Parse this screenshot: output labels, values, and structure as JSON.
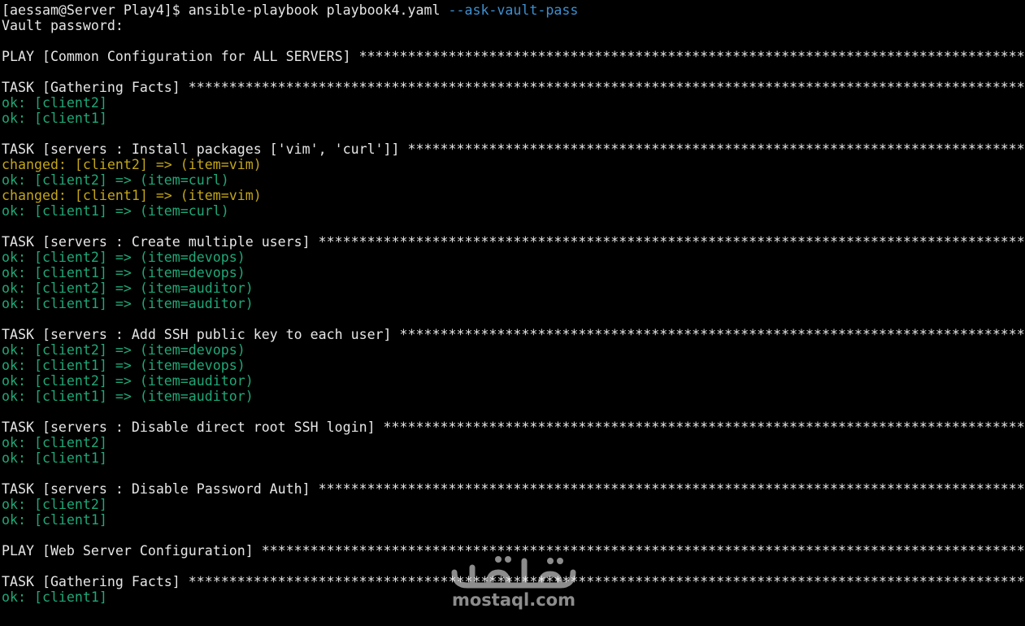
{
  "terminal": {
    "prompt": "[aessam@Server Play4]$ ",
    "command": "ansible-playbook playbook4.yaml ",
    "command_flag": "--ask-vault-pass",
    "vault_prompt": "Vault password:",
    "stars": "***************************************************************************************************************************"
  },
  "blocks": [
    {
      "header": "PLAY [Common Configuration for ALL SERVERS] ",
      "results": []
    },
    {
      "header": "TASK [Gathering Facts] ",
      "results": [
        {
          "status": "ok",
          "text": "ok: [client2]"
        },
        {
          "status": "ok",
          "text": "ok: [client1]"
        }
      ]
    },
    {
      "header": "TASK [servers : Install packages ['vim', 'curl']] ",
      "results": [
        {
          "status": "changed",
          "text": "changed: [client2] => (item=vim)"
        },
        {
          "status": "ok",
          "text": "ok: [client2] => (item=curl)"
        },
        {
          "status": "changed",
          "text": "changed: [client1] => (item=vim)"
        },
        {
          "status": "ok",
          "text": "ok: [client1] => (item=curl)"
        }
      ]
    },
    {
      "header": "TASK [servers : Create multiple users] ",
      "results": [
        {
          "status": "ok",
          "text": "ok: [client2] => (item=devops)"
        },
        {
          "status": "ok",
          "text": "ok: [client1] => (item=devops)"
        },
        {
          "status": "ok",
          "text": "ok: [client2] => (item=auditor)"
        },
        {
          "status": "ok",
          "text": "ok: [client1] => (item=auditor)"
        }
      ]
    },
    {
      "header": "TASK [servers : Add SSH public key to each user] ",
      "results": [
        {
          "status": "ok",
          "text": "ok: [client2] => (item=devops)"
        },
        {
          "status": "ok",
          "text": "ok: [client1] => (item=devops)"
        },
        {
          "status": "ok",
          "text": "ok: [client2] => (item=auditor)"
        },
        {
          "status": "ok",
          "text": "ok: [client1] => (item=auditor)"
        }
      ]
    },
    {
      "header": "TASK [servers : Disable direct root SSH login] ",
      "results": [
        {
          "status": "ok",
          "text": "ok: [client2]"
        },
        {
          "status": "ok",
          "text": "ok: [client1]"
        }
      ]
    },
    {
      "header": "TASK [servers : Disable Password Auth] ",
      "results": [
        {
          "status": "ok",
          "text": "ok: [client2]"
        },
        {
          "status": "ok",
          "text": "ok: [client1]"
        }
      ]
    },
    {
      "header": "PLAY [Web Server Configuration] ",
      "results": []
    },
    {
      "header": "TASK [Gathering Facts] ",
      "results": [
        {
          "status": "ok",
          "text": "ok: [client1]"
        }
      ]
    }
  ],
  "watermark": {
    "text": "mostaql.com",
    "logo_icon": "mostaql-logo-icon"
  },
  "colors": {
    "background": "#000000",
    "text": "#e6e6e6",
    "ok": "#1fa877",
    "changed": "#c3a51a",
    "flag": "#3e8fd0"
  }
}
